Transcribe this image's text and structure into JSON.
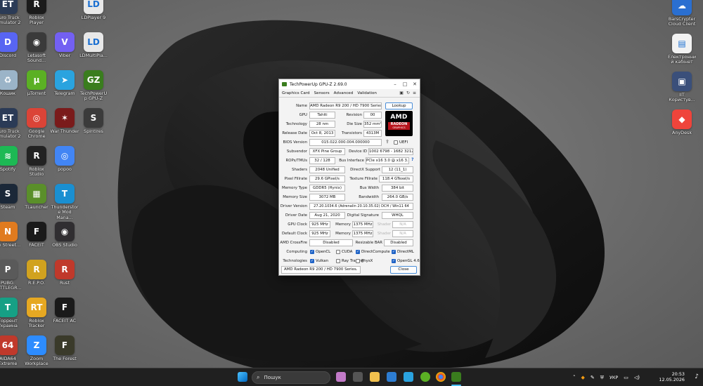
{
  "desktop_icons_left": [
    {
      "label": "Euro Truck Simulator 2",
      "icon": "truck-icon",
      "color": "#2b3b56",
      "glyph": "ET"
    },
    {
      "label": "Roblox Player",
      "icon": "roblox-icon",
      "color": "#1b1b1b",
      "glyph": "R"
    },
    {
      "label": "LDPlayer 9",
      "icon": "ldplayer-icon",
      "color": "#e8e8e8",
      "glyph": "LD"
    },
    {
      "label": "Discord",
      "icon": "discord-icon",
      "color": "#5865f2",
      "glyph": "D"
    },
    {
      "label": "Letasoft Sound...",
      "icon": "speaker-icon",
      "color": "#3a3a3a",
      "glyph": "◉"
    },
    {
      "label": "Viber",
      "icon": "viber-icon",
      "color": "#7360f2",
      "glyph": "V"
    },
    {
      "label": "LDMultiPla...",
      "icon": "ldmulti-icon",
      "color": "#e8e8e8",
      "glyph": "LD"
    },
    {
      "label": "Кошик",
      "icon": "recycle-bin-icon",
      "color": "#9bb4c8",
      "glyph": "♻"
    },
    {
      "label": "µTorrent",
      "icon": "utorrent-icon",
      "color": "#5bb024",
      "glyph": "µ"
    },
    {
      "label": "Telegram",
      "icon": "telegram-icon",
      "color": "#2aa3df",
      "glyph": "➤"
    },
    {
      "label": "TechPowerUp GPU-Z",
      "icon": "gpuz-icon",
      "color": "#3a7d1e",
      "glyph": "GZ"
    },
    {
      "label": "Euro Truck Simulator 2",
      "icon": "truck-icon",
      "color": "#2b3b56",
      "glyph": "ET"
    },
    {
      "label": "Google Chrome",
      "icon": "chrome-icon",
      "color": "#db4437",
      "glyph": "◎"
    },
    {
      "label": "War Thunder",
      "icon": "warthunder-icon",
      "color": "#7a1b1b",
      "glyph": "✶"
    },
    {
      "label": "Spintires",
      "icon": "spintires-icon",
      "color": "#3b3b3b",
      "glyph": "S"
    },
    {
      "label": "Spotify",
      "icon": "spotify-icon",
      "color": "#1db954",
      "glyph": "≋"
    },
    {
      "label": "Roblox Studio",
      "icon": "roblox-studio-icon",
      "color": "#222222",
      "glyph": "R"
    },
    {
      "label": "popoo",
      "icon": "chrome-popoo-icon",
      "color": "#4285f4",
      "glyph": "◎"
    },
    {
      "label": "Steam",
      "icon": "steam-icon",
      "color": "#1b2838",
      "glyph": "S"
    },
    {
      "label": "TLauncher",
      "icon": "tlauncher-icon",
      "color": "#5a8f2a",
      "glyph": "▦"
    },
    {
      "label": "Thunderstore Mod Mana...",
      "icon": "thunderstore-icon",
      "color": "#1a8fd1",
      "glyph": "T"
    },
    {
      "label": "Не Street...",
      "icon": "game-icon",
      "color": "#e07b1f",
      "glyph": "N"
    },
    {
      "label": "FACEIT",
      "icon": "faceit-icon",
      "color": "#1a1a1a",
      "glyph": "F"
    },
    {
      "label": "OBS Studio",
      "icon": "obs-icon",
      "color": "#302e31",
      "glyph": "◉"
    },
    {
      "label": "PUBG: BATTLEGR...",
      "icon": "pubg-icon",
      "color": "#5a5a5a",
      "glyph": "P"
    },
    {
      "label": "R.E.P.O.",
      "icon": "repo-icon",
      "color": "#d1a21f",
      "glyph": "R"
    },
    {
      "label": "Rust",
      "icon": "rust-icon",
      "color": "#c0392b",
      "glyph": "R"
    },
    {
      "label": "Торрент Украина",
      "icon": "torrent-ua-icon",
      "color": "#16a085",
      "glyph": "T"
    },
    {
      "label": "Roblox Tracker",
      "icon": "roblox-tracker-icon",
      "color": "#e6a822",
      "glyph": "RT"
    },
    {
      "label": "FACEIT AC",
      "icon": "faceit-ac-icon",
      "color": "#1a1a1a",
      "glyph": "F"
    },
    {
      "label": "AIDA64 Extreme",
      "icon": "aida64-icon",
      "color": "#c0392b",
      "glyph": "64"
    },
    {
      "label": "Zoom Workplace",
      "icon": "zoom-icon",
      "color": "#2d8cff",
      "glyph": "Z"
    },
    {
      "label": "The Forest",
      "icon": "forest-icon",
      "color": "#3a3a2a",
      "glyph": "F"
    }
  ],
  "desktop_icons_right": [
    {
      "label": "BarsCrypter Cloud Client",
      "icon": "cloud-icon",
      "color": "#2a6fd1",
      "glyph": "☁"
    },
    {
      "label": "Електронний кабінет",
      "icon": "cabinet-icon",
      "color": "#f2f2f2",
      "glyph": "▤"
    },
    {
      "label": "ІІТ Користув...",
      "icon": "iit-icon",
      "color": "#3a4f7a",
      "glyph": "▣"
    },
    {
      "label": "AnyDesk",
      "icon": "anydesk-icon",
      "color": "#ef443b",
      "glyph": "◆"
    }
  ],
  "gpuz": {
    "title": "TechPowerUp GPU-Z 2.69.0",
    "tabs": [
      "Graphics Card",
      "Sensors",
      "Advanced",
      "Validation"
    ],
    "labels": {
      "name": "Name",
      "gpu": "GPU",
      "revision": "Revision",
      "technology": "Technology",
      "die_size": "Die Size",
      "release_date": "Release Date",
      "transistors": "Transistors",
      "bios_version": "BIOS Version",
      "subvendor": "Subvendor",
      "device_id": "Device ID",
      "rops": "ROPs/TMUs",
      "bus_interface": "Bus Interface",
      "shaders": "Shaders",
      "directx": "DirectX Support",
      "pixel_fillrate": "Pixel Fillrate",
      "texture_fillrate": "Texture Fillrate",
      "memory_type": "Memory Type",
      "bus_width": "Bus Width",
      "memory_size": "Memory Size",
      "bandwidth": "Bandwidth",
      "driver_version": "Driver Version",
      "driver_date": "Driver Date",
      "digital_signature": "Digital Signature",
      "gpu_clock": "GPU Clock",
      "memory": "Memory",
      "shader": "Shader",
      "default_clock": "Default Clock",
      "crossfire": "AMD CrossFire",
      "resizable_bar": "Resizable BAR",
      "computing": "Computing",
      "technologies": "Technologies",
      "uefi": "UEFI"
    },
    "values": {
      "name": "AMD Radeon R9 200 / HD 7900 Series",
      "gpu": "Tahiti",
      "revision": "00",
      "technology": "28 nm",
      "die_size": "352 mm²",
      "release_date": "Oct 8, 2013",
      "transistors": "4313M",
      "bios_version": "015.022.000.004.000000",
      "subvendor": "XFX Pine Group",
      "device_id": "1002 6798 - 1682 3212",
      "rops": "32 / 128",
      "bus_interface": "PCIe x16 3.0 @ x16 3.0",
      "shaders": "2048 Unified",
      "directx": "12 (11_1)",
      "pixel_fillrate": "29.6 GPixel/s",
      "texture_fillrate": "118.4 GTexel/s",
      "memory_type": "GDDR5 (Hynix)",
      "bus_width": "384 bit",
      "memory_size": "3072 MB",
      "bandwidth": "264.0 GB/s",
      "driver_version": "27.20.1034.6 (Adrenalin 20.10.35.02) DCH / Win11 64",
      "driver_date": "Aug 21, 2020",
      "digital_signature": "WHQL",
      "gpu_clock": "925 MHz",
      "gpu_memory": "1375 MHz",
      "gpu_shader": "N/A",
      "default_clock": "925 MHz",
      "default_memory": "1375 MHz",
      "default_shader": "N/A",
      "crossfire": "Disabled",
      "resizable_bar": "Disabled"
    },
    "computing": [
      {
        "label": "OpenCL",
        "checked": true
      },
      {
        "label": "CUDA",
        "checked": false
      },
      {
        "label": "DirectCompute",
        "checked": true
      },
      {
        "label": "DirectML",
        "checked": true
      }
    ],
    "technologies": [
      {
        "label": "Vulkan",
        "checked": true
      },
      {
        "label": "Ray Tracing",
        "checked": false
      },
      {
        "label": "PhysX",
        "checked": false
      },
      {
        "label": "OpenGL 4.6",
        "checked": true
      }
    ],
    "lookup_button": "Lookup",
    "close_button": "Close",
    "selected_gpu": "AMD Radeon R9 200 / HD 7900 Series",
    "logo": {
      "brand": "AMD",
      "line1": "RADEON",
      "line2": "GRAPHICS"
    },
    "help": "?"
  },
  "taskbar": {
    "search_placeholder": "Пошук",
    "language": "УКР",
    "time": "20:53",
    "date": "12.05.2026",
    "accent": "#202020"
  }
}
